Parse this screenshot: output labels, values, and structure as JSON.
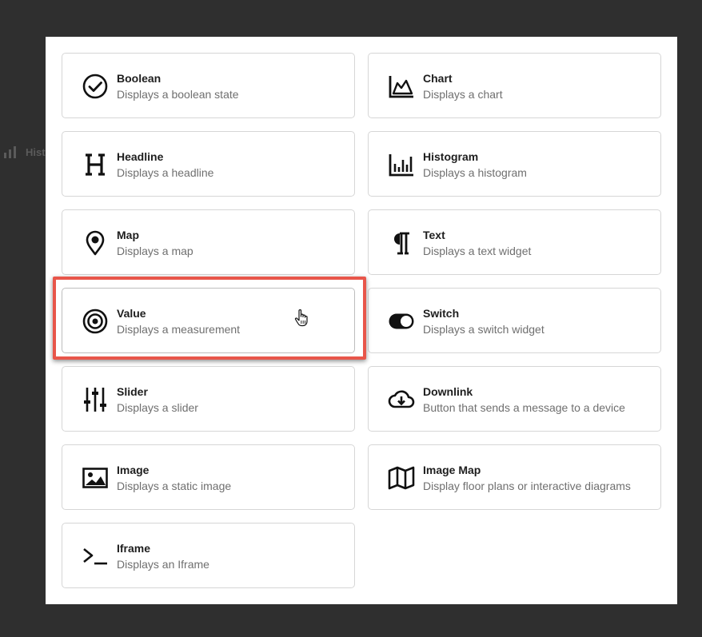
{
  "background": {
    "peek_text": "Hist"
  },
  "widgets": [
    {
      "title": "Boolean",
      "desc": "Displays a boolean state",
      "icon": "check-circle-icon"
    },
    {
      "title": "Chart",
      "desc": "Displays a chart",
      "icon": "area-chart-icon"
    },
    {
      "title": "Headline",
      "desc": "Displays a headline",
      "icon": "headline-icon"
    },
    {
      "title": "Histogram",
      "desc": "Displays a histogram",
      "icon": "histogram-icon"
    },
    {
      "title": "Map",
      "desc": "Displays a map",
      "icon": "map-pin-icon"
    },
    {
      "title": "Text",
      "desc": "Displays a text widget",
      "icon": "paragraph-icon"
    },
    {
      "title": "Value",
      "desc": "Displays a measurement",
      "icon": "target-icon"
    },
    {
      "title": "Switch",
      "desc": "Displays a switch widget",
      "icon": "toggle-icon"
    },
    {
      "title": "Slider",
      "desc": "Displays a slider",
      "icon": "sliders-icon"
    },
    {
      "title": "Downlink",
      "desc": "Button that sends a message to a device",
      "icon": "cloud-download-icon"
    },
    {
      "title": "Image",
      "desc": "Displays a static image",
      "icon": "image-icon"
    },
    {
      "title": "Image Map",
      "desc": "Display floor plans or interactive diagrams",
      "icon": "folded-map-icon"
    },
    {
      "title": "Iframe",
      "desc": "Displays an Iframe",
      "icon": "terminal-icon"
    }
  ],
  "colors": {
    "highlight": "#e8564a",
    "backdrop": "#2f2f2f"
  }
}
